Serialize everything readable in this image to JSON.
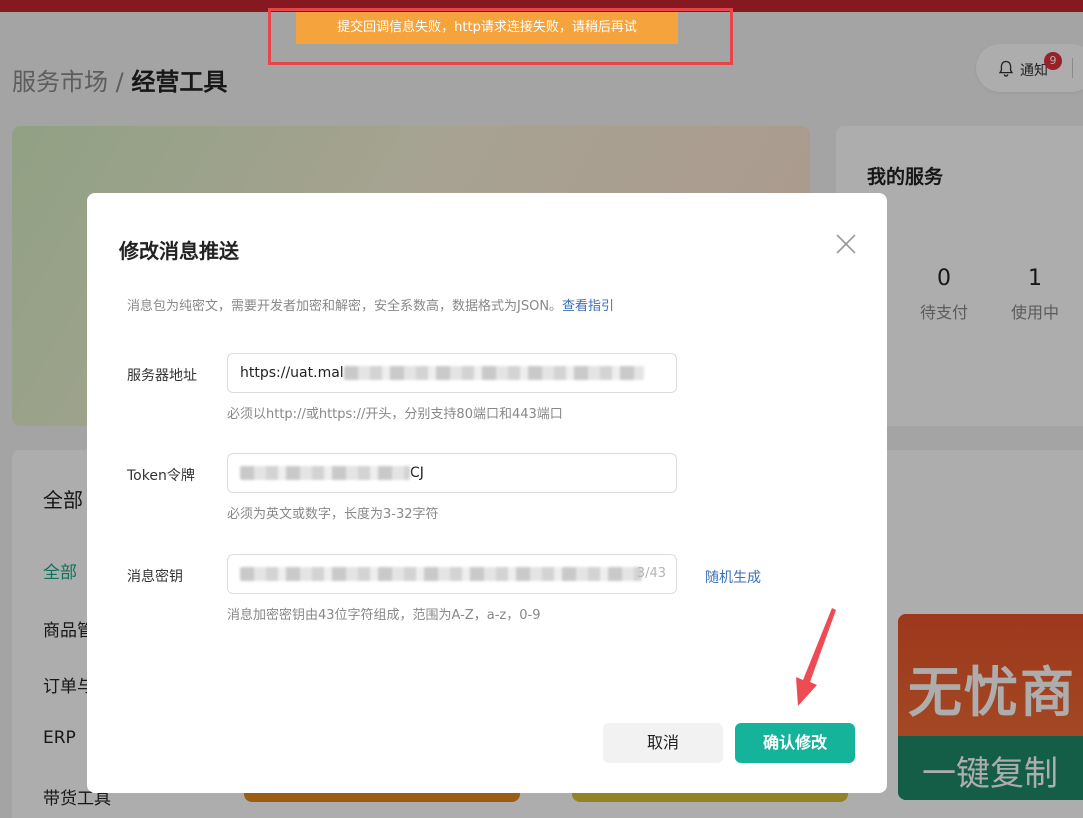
{
  "background": {
    "breadcrumb": {
      "parent": "服务市场",
      "separator": " / ",
      "current": "经营工具"
    },
    "notification": {
      "label": "通知",
      "badge": "9"
    },
    "my_services": {
      "title": "我的服务",
      "stats": [
        {
          "value": "0",
          "label": "待支付"
        },
        {
          "value": "1",
          "label": "使用中"
        }
      ]
    },
    "categories": {
      "title": "全部",
      "items": [
        "全部",
        "商品管",
        "订单与",
        "ERP",
        "带货工具"
      ]
    },
    "promo": {
      "headline": "无忧商",
      "subline": "一键复制"
    }
  },
  "toast": {
    "message": "提交回调信息失败，http请求连接失败，请稍后再试"
  },
  "modal": {
    "title": "修改消息推送",
    "description": "消息包为纯密文，需要开发者加密和解密，安全系数高，数据格式为JSON。",
    "guide_link": "查看指引",
    "fields": {
      "server_url": {
        "label": "服务器地址",
        "value_visible": "https://uat.mal",
        "hint": "必须以http://或https://开头，分别支持80端口和443端口"
      },
      "token": {
        "label": "Token令牌",
        "value_visible": "CJ",
        "hint": "必须为英文或数字，长度为3-32字符"
      },
      "secret_key": {
        "label": "消息密钥",
        "counter": "3/43",
        "hint": "消息加密密钥由43位字符组成，范围为A-Z，a-z，0-9",
        "random_label": "随机生成"
      }
    },
    "buttons": {
      "cancel": "取消",
      "confirm": "确认修改"
    }
  },
  "colors": {
    "accent": "#14b39a",
    "link": "#3b6fb6",
    "toast_bg": "#f5a33c",
    "highlight_outline": "#e8454b",
    "top_bar": "#c6262e"
  }
}
